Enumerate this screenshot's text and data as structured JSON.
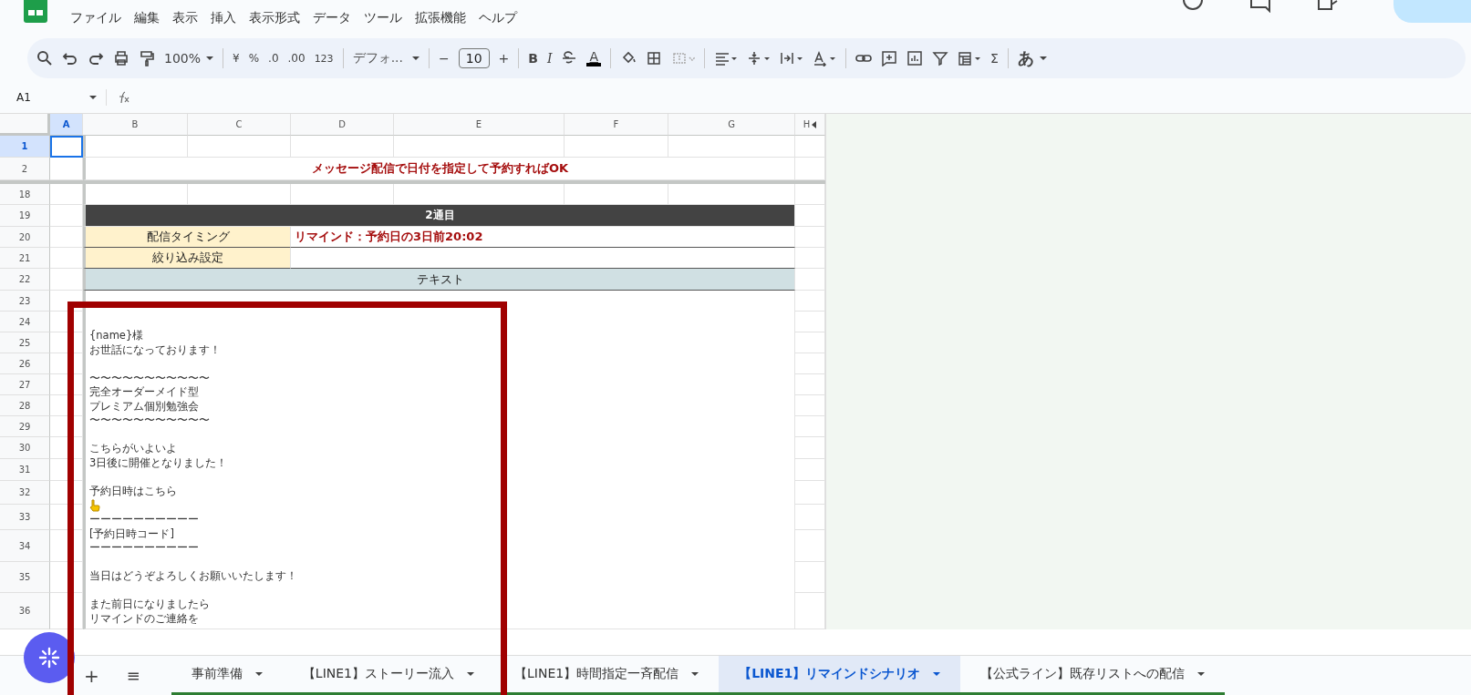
{
  "menu": [
    "ファイル",
    "編集",
    "表示",
    "挿入",
    "表示形式",
    "データ",
    "ツール",
    "拡張機能",
    "ヘルプ"
  ],
  "toolbar": {
    "zoom": "100%",
    "currency": "¥",
    "percent": "%",
    "decrease_decimal": ".0",
    "increase_decimal": ".00",
    "number_format": "123",
    "font": "デフォ...",
    "minus": "−",
    "font_size": "10",
    "plus": "+",
    "bold": "B",
    "italic": "I",
    "text_color": "A",
    "sum": "Σ",
    "input_tools": "あ"
  },
  "formula_bar": {
    "cell_ref": "A1"
  },
  "sheet": {
    "columns": [
      {
        "label": "A",
        "selected": true
      },
      {
        "label": "B",
        "selected": false
      },
      {
        "label": "C",
        "selected": false
      },
      {
        "label": "D",
        "selected": false
      },
      {
        "label": "E",
        "selected": false
      },
      {
        "label": "F",
        "selected": false
      },
      {
        "label": "G",
        "selected": false
      },
      {
        "label": "H",
        "selected": false
      }
    ],
    "rows": [
      {
        "number": "1",
        "selected": true,
        "kind": "blank"
      },
      {
        "number": "2",
        "selected": false,
        "kind": "notice",
        "text": "メッセージ配信で日付を指定して予約すればOK"
      },
      {
        "number": "18",
        "selected": false,
        "kind": "blank"
      },
      {
        "number": "19",
        "selected": false,
        "kind": "header",
        "text": "2通目"
      },
      {
        "number": "20",
        "selected": false,
        "kind": "setting",
        "label": "配信タイミング",
        "value": "リマインド：予約日の3日前20:02"
      },
      {
        "number": "21",
        "selected": false,
        "kind": "setting",
        "label": "絞り込み設定"
      },
      {
        "number": "22",
        "selected": false,
        "kind": "section",
        "text": "テキスト"
      },
      {
        "number": "23",
        "selected": false,
        "kind": "body",
        "paragraphs": [
          [
            {
              "kind": "text",
              "text": "{name}様"
            },
            {
              "kind": "text",
              "text": "お世話になっております！"
            }
          ],
          [
            {
              "kind": "text",
              "text": "〜〜〜〜〜〜〜〜〜〜〜"
            },
            {
              "kind": "text",
              "text": "完全オーダーメイド型"
            },
            {
              "kind": "text",
              "text": "プレミアム個別勉強会"
            },
            {
              "kind": "text",
              "text": "〜〜〜〜〜〜〜〜〜〜〜"
            }
          ],
          [
            {
              "kind": "text",
              "text": "こちらがいよいよ"
            },
            {
              "kind": "text",
              "text": "3日後に開催となりました！"
            }
          ],
          [
            {
              "kind": "text",
              "text": "予約日時はこちら"
            },
            {
              "kind": "pointing-hand"
            },
            {
              "kind": "text",
              "text": "ーーーーーーーーーー"
            },
            {
              "kind": "text",
              "text": "[予約日時コード]"
            },
            {
              "kind": "text",
              "text": "ーーーーーーーーーー"
            }
          ],
          [
            {
              "kind": "text",
              "text": "当日はどうぞよろしくお願いいたします！"
            }
          ],
          [
            {
              "kind": "text",
              "text": "また前日になりましたら"
            },
            {
              "kind": "text",
              "text": "リマインドのご連絡を"
            }
          ]
        ]
      },
      {
        "number": "24",
        "selected": false,
        "kind": "covered"
      },
      {
        "number": "25",
        "selected": false,
        "kind": "covered"
      },
      {
        "number": "26",
        "selected": false,
        "kind": "covered"
      },
      {
        "number": "27",
        "selected": false,
        "kind": "covered"
      },
      {
        "number": "28",
        "selected": false,
        "kind": "covered"
      },
      {
        "number": "29",
        "selected": false,
        "kind": "covered"
      },
      {
        "number": "30",
        "selected": false,
        "kind": "covered"
      },
      {
        "number": "31",
        "selected": false,
        "kind": "covered"
      },
      {
        "number": "32",
        "selected": false,
        "kind": "covered"
      },
      {
        "number": "33",
        "selected": false,
        "kind": "covered"
      },
      {
        "number": "34",
        "selected": false,
        "kind": "covered"
      },
      {
        "number": "35",
        "selected": false,
        "kind": "covered"
      },
      {
        "number": "36",
        "selected": false,
        "kind": "covered"
      }
    ]
  },
  "sheet_tabs": {
    "add": "+",
    "list": "≡",
    "tabs": [
      {
        "label": "事前準備",
        "selected": false
      },
      {
        "label": "【LINE1】ストーリー流入",
        "selected": false
      },
      {
        "label": "【LINE1】時間指定一斉配信",
        "selected": false
      },
      {
        "label": "【LINE1】リマインドシナリオ",
        "selected": true
      },
      {
        "label": "【公式ライン】既存リストへの配信",
        "selected": false
      }
    ]
  }
}
